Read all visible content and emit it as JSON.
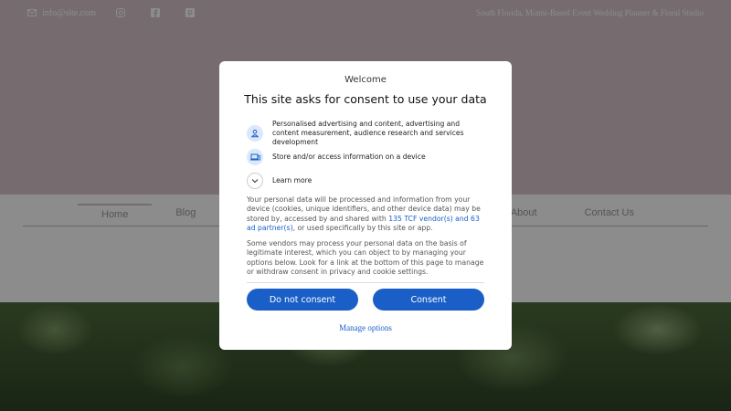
{
  "site": {
    "email": "info@site.com",
    "tagline": "South Florida, Miami-Based Event Wedding Planner & Floral Studio",
    "nav": [
      "Home",
      "Blog"
    ],
    "nav_right": [
      "About",
      "Contact Us"
    ]
  },
  "dialog": {
    "welcome": "Welcome",
    "title": "This site asks for consent to use your data",
    "purposes": [
      {
        "icon": "person-icon",
        "text": "Personalised advertising and content, advertising and content measurement, audience research and services development"
      },
      {
        "icon": "device-icon",
        "text": "Store and/or access information on a device"
      },
      {
        "icon": "chevron-down-icon",
        "text": "Learn more"
      }
    ],
    "para1_before": "Your personal data will be processed and information from your device (cookies, unique identifiers, and other device data) may be stored by, accessed by and shared with ",
    "para1_link": "135 TCF vendor(s) and 63 ad partner(s)",
    "para1_after": ", or used specifically by this site or app.",
    "para2": "Some vendors may process your personal data on the basis of legitimate interest, which you can object to by managing your options below. Look for a link at the bottom of this page to manage or withdraw consent in privacy and cookie settings.",
    "do_not_consent": "Do not consent",
    "consent": "Consent",
    "manage": "Manage options"
  },
  "colors": {
    "accent": "#1a5fc7",
    "header_bg": "#d7c4c8",
    "icon_bg": "#dbe7fb"
  }
}
